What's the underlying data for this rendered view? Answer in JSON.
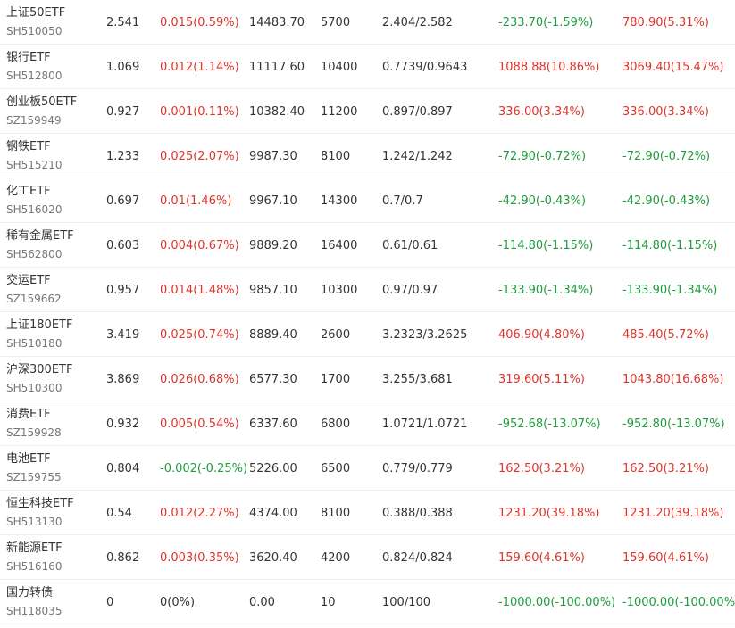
{
  "colors": {
    "up": "#e0342b",
    "down": "#1f9d3d",
    "neutral": "#333333"
  },
  "rows": [
    {
      "name": "上证50ETF",
      "code": "SH510050",
      "price": "2.541",
      "change": "0.015(0.59%)",
      "change_dir": "up",
      "market_value": "14483.70",
      "qty": "5700",
      "cost": "2.404/2.582",
      "pl1": "-233.70(-1.59%)",
      "pl1_dir": "down",
      "pl2": "780.90(5.31%)",
      "pl2_dir": "up"
    },
    {
      "name": "银行ETF",
      "code": "SH512800",
      "price": "1.069",
      "change": "0.012(1.14%)",
      "change_dir": "up",
      "market_value": "11117.60",
      "qty": "10400",
      "cost": "0.7739/0.9643",
      "pl1": "1088.88(10.86%)",
      "pl1_dir": "up",
      "pl2": "3069.40(15.47%)",
      "pl2_dir": "up"
    },
    {
      "name": "创业板50ETF",
      "code": "SZ159949",
      "price": "0.927",
      "change": "0.001(0.11%)",
      "change_dir": "up",
      "market_value": "10382.40",
      "qty": "11200",
      "cost": "0.897/0.897",
      "pl1": "336.00(3.34%)",
      "pl1_dir": "up",
      "pl2": "336.00(3.34%)",
      "pl2_dir": "up"
    },
    {
      "name": "钢铁ETF",
      "code": "SH515210",
      "price": "1.233",
      "change": "0.025(2.07%)",
      "change_dir": "up",
      "market_value": "9987.30",
      "qty": "8100",
      "cost": "1.242/1.242",
      "pl1": "-72.90(-0.72%)",
      "pl1_dir": "down",
      "pl2": "-72.90(-0.72%)",
      "pl2_dir": "down"
    },
    {
      "name": "化工ETF",
      "code": "SH516020",
      "price": "0.697",
      "change": "0.01(1.46%)",
      "change_dir": "up",
      "market_value": "9967.10",
      "qty": "14300",
      "cost": "0.7/0.7",
      "pl1": "-42.90(-0.43%)",
      "pl1_dir": "down",
      "pl2": "-42.90(-0.43%)",
      "pl2_dir": "down"
    },
    {
      "name": "稀有金属ETF",
      "code": "SH562800",
      "price": "0.603",
      "change": "0.004(0.67%)",
      "change_dir": "up",
      "market_value": "9889.20",
      "qty": "16400",
      "cost": "0.61/0.61",
      "pl1": "-114.80(-1.15%)",
      "pl1_dir": "down",
      "pl2": "-114.80(-1.15%)",
      "pl2_dir": "down"
    },
    {
      "name": "交运ETF",
      "code": "SZ159662",
      "price": "0.957",
      "change": "0.014(1.48%)",
      "change_dir": "up",
      "market_value": "9857.10",
      "qty": "10300",
      "cost": "0.97/0.97",
      "pl1": "-133.90(-1.34%)",
      "pl1_dir": "down",
      "pl2": "-133.90(-1.34%)",
      "pl2_dir": "down"
    },
    {
      "name": "上证180ETF",
      "code": "SH510180",
      "price": "3.419",
      "change": "0.025(0.74%)",
      "change_dir": "up",
      "market_value": "8889.40",
      "qty": "2600",
      "cost": "3.2323/3.2625",
      "pl1": "406.90(4.80%)",
      "pl1_dir": "up",
      "pl2": "485.40(5.72%)",
      "pl2_dir": "up"
    },
    {
      "name": "沪深300ETF",
      "code": "SH510300",
      "price": "3.869",
      "change": "0.026(0.68%)",
      "change_dir": "up",
      "market_value": "6577.30",
      "qty": "1700",
      "cost": "3.255/3.681",
      "pl1": "319.60(5.11%)",
      "pl1_dir": "up",
      "pl2": "1043.80(16.68%)",
      "pl2_dir": "up"
    },
    {
      "name": "消费ETF",
      "code": "SZ159928",
      "price": "0.932",
      "change": "0.005(0.54%)",
      "change_dir": "up",
      "market_value": "6337.60",
      "qty": "6800",
      "cost": "1.0721/1.0721",
      "pl1": "-952.68(-13.07%)",
      "pl1_dir": "down",
      "pl2": "-952.80(-13.07%)",
      "pl2_dir": "down"
    },
    {
      "name": "电池ETF",
      "code": "SZ159755",
      "price": "0.804",
      "change": "-0.002(-0.25%)",
      "change_dir": "down",
      "market_value": "5226.00",
      "qty": "6500",
      "cost": "0.779/0.779",
      "pl1": "162.50(3.21%)",
      "pl1_dir": "up",
      "pl2": "162.50(3.21%)",
      "pl2_dir": "up"
    },
    {
      "name": "恒生科技ETF",
      "code": "SH513130",
      "price": "0.54",
      "change": "0.012(2.27%)",
      "change_dir": "up",
      "market_value": "4374.00",
      "qty": "8100",
      "cost": "0.388/0.388",
      "pl1": "1231.20(39.18%)",
      "pl1_dir": "up",
      "pl2": "1231.20(39.18%)",
      "pl2_dir": "up"
    },
    {
      "name": "新能源ETF",
      "code": "SH516160",
      "price": "0.862",
      "change": "0.003(0.35%)",
      "change_dir": "up",
      "market_value": "3620.40",
      "qty": "4200",
      "cost": "0.824/0.824",
      "pl1": "159.60(4.61%)",
      "pl1_dir": "up",
      "pl2": "159.60(4.61%)",
      "pl2_dir": "up"
    },
    {
      "name": "国力转债",
      "code": "SH118035",
      "price": "0",
      "change": "0(0%)",
      "change_dir": "neutral",
      "market_value": "0.00",
      "qty": "10",
      "cost": "100/100",
      "pl1": "-1000.00(-100.00%)",
      "pl1_dir": "down",
      "pl2": "-1000.00(-100.00%)",
      "pl2_dir": "down"
    }
  ]
}
